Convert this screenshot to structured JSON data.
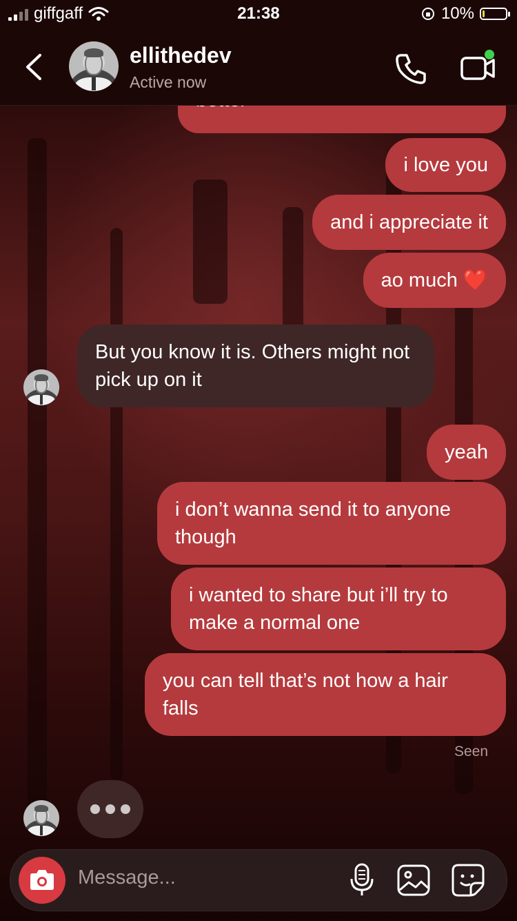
{
  "status_bar": {
    "carrier": "giffgaff",
    "time": "21:38",
    "battery_percent": "10%",
    "battery_level": 0.1
  },
  "header": {
    "back_icon": "chevron-left-icon",
    "username": "ellithedev",
    "presence": "Active now",
    "call_icon": "phone-icon",
    "video_icon": "video-camera-icon",
    "online_indicator_color": "#3ed34a"
  },
  "messages": [
    {
      "direction": "out",
      "text": "better"
    },
    {
      "direction": "out",
      "text": "i love you"
    },
    {
      "direction": "out",
      "text": "and i appreciate it"
    },
    {
      "direction": "out",
      "text": "ao much ❤️"
    },
    {
      "direction": "in",
      "text": "But you know it is. Others might not pick up on it"
    },
    {
      "direction": "out",
      "text": "yeah"
    },
    {
      "direction": "out",
      "text": "i don’t wanna send it to anyone though"
    },
    {
      "direction": "out",
      "text": "i wanted to share but i’ll try to make a normal one"
    },
    {
      "direction": "out",
      "text": "you can tell that’s not how a hair falls"
    }
  ],
  "seen_label": "Seen",
  "typing_indicator": true,
  "composer": {
    "placeholder": "Message...",
    "camera_icon": "camera-icon",
    "mic_icon": "microphone-icon",
    "gallery_icon": "gallery-icon",
    "sticker_icon": "sticker-icon"
  },
  "colors": {
    "outgoing_bubble": "#b53a3d",
    "incoming_bubble": "#3f2727",
    "camera_button": "#d73a40"
  }
}
